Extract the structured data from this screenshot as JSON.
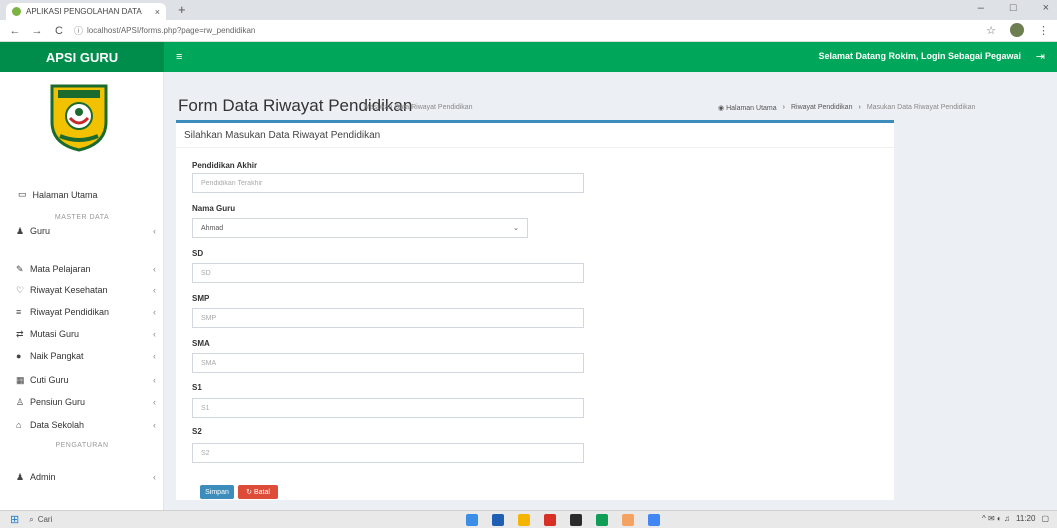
{
  "browser": {
    "tab_title": "APLIKASI PENGOLAHAN DATA",
    "tab_close": "×",
    "new_tab": "+",
    "url": "localhost/APSI/forms.php?page=rw_pendidikan",
    "nav_back": "←",
    "nav_forward": "→",
    "nav_reload": "C",
    "info_glyph": "ⓘ",
    "star_glyph": "☆",
    "menu_glyph": "⋮",
    "window_controls": [
      "–",
      "□",
      "×"
    ]
  },
  "header": {
    "app_name": "APSI GURU",
    "toggle_glyph": "≡",
    "welcome": "Selamat Datang Rokim, Login Sebagai Pegawai",
    "logout_glyph": "⇥"
  },
  "sidebar": {
    "home_label": "Halaman Utama",
    "home_icon": "monitor-icon",
    "section_main": "MASTER DATA",
    "section_settings": "PENGATURAN",
    "items": [
      {
        "label": "Guru",
        "icon": "users-icon",
        "glyph": "♟"
      },
      {
        "label": "Mata Pelajaran",
        "icon": "book-icon",
        "glyph": "✎"
      },
      {
        "label": "Riwayat Kesehatan",
        "icon": "heartbeat-icon",
        "glyph": "♡"
      },
      {
        "label": "Riwayat Pendidikan",
        "icon": "graduation-icon",
        "glyph": "≡"
      },
      {
        "label": "Mutasi Guru",
        "icon": "exchange-icon",
        "glyph": "⇄"
      },
      {
        "label": "Naik Pangkat",
        "icon": "level-up-icon",
        "glyph": "●"
      },
      {
        "label": "Cuti Guru",
        "icon": "calendar-icon",
        "glyph": "▦"
      },
      {
        "label": "Pensiun Guru",
        "icon": "user-icon",
        "glyph": "♙"
      },
      {
        "label": "Data Sekolah",
        "icon": "school-icon",
        "glyph": "⌂"
      },
      {
        "label": "Admin",
        "icon": "admin-icon",
        "glyph": "♟"
      }
    ],
    "chevron": "‹"
  },
  "content": {
    "title": "Form Data Riwayat Pendidikan",
    "subtitle": "Masukan Data Riwayat Pendidikan",
    "breadcrumb": [
      "Halaman Utama",
      "Riwayat Pendidikan",
      "Masukan Data Riwayat Pendidikan"
    ],
    "breadcrumb_sep": "›",
    "box_title": "Silahkan Masukan Data Riwayat Pendidikan"
  },
  "form": {
    "pendidikan_label": "Pendidikan Akhir",
    "pendidikan_placeholder": "Pendidikan Terakhir",
    "guru_label": "Nama Guru",
    "guru_selected": "Ahmad",
    "sd_label": "SD",
    "sd_placeholder": "SD",
    "smp_label": "SMP",
    "smp_placeholder": "SMP",
    "sma_label": "SMA",
    "sma_placeholder": "SMA",
    "s1_label": "S1",
    "s1_placeholder": "S1",
    "s2_label": "S2",
    "s2_placeholder": "S2",
    "save_label": "Simpan",
    "reset_label": "Batal"
  },
  "taskbar": {
    "search_text": "Cari",
    "time": "11:20",
    "tray_glyphs": "^ ✉ ◐ ♫"
  },
  "colors": {
    "brand_green": "#00a65a",
    "logo_green": "#008d4c",
    "primary_blue": "#3c8dbc",
    "danger_red": "#dd4b39"
  }
}
